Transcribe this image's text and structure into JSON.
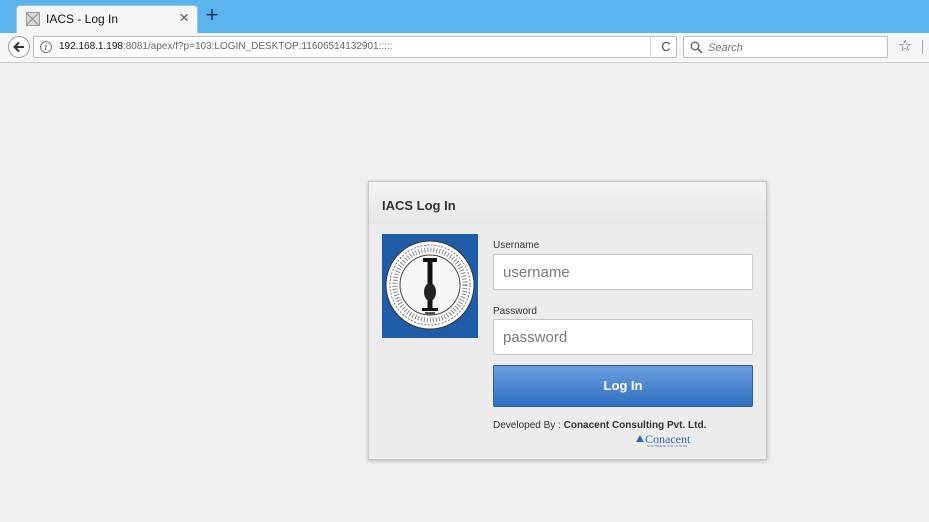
{
  "browser": {
    "tab": {
      "title": "IACS - Log In",
      "close_glyph": "×",
      "favicon": "page-icon"
    },
    "new_tab_glyph": "+",
    "url": {
      "host": "192.168.1.198",
      "rest": ":8081/apex/f?p=103:LOGIN_DESKTOP:11606514132901:::::"
    },
    "reload_glyph": "C",
    "search": {
      "placeholder": "Search"
    },
    "bookmark_glyph": "☆"
  },
  "login": {
    "title": "IACS Log In",
    "username_label": "Username",
    "username_placeholder": "username",
    "password_label": "Password",
    "password_placeholder": "password",
    "submit_label": "Log In",
    "developed_by_prefix": "Developed By : ",
    "developed_by_company": "Conacent Consulting Pvt. Ltd.",
    "brand_logo_text": "Conacent",
    "brand_logo_tagline": "SOFTWARE SOLUTIONS"
  },
  "colors": {
    "tabstrip": "#5ab3ec",
    "login_button": "#3b78c8",
    "logo_background": "#1f5ca8"
  }
}
